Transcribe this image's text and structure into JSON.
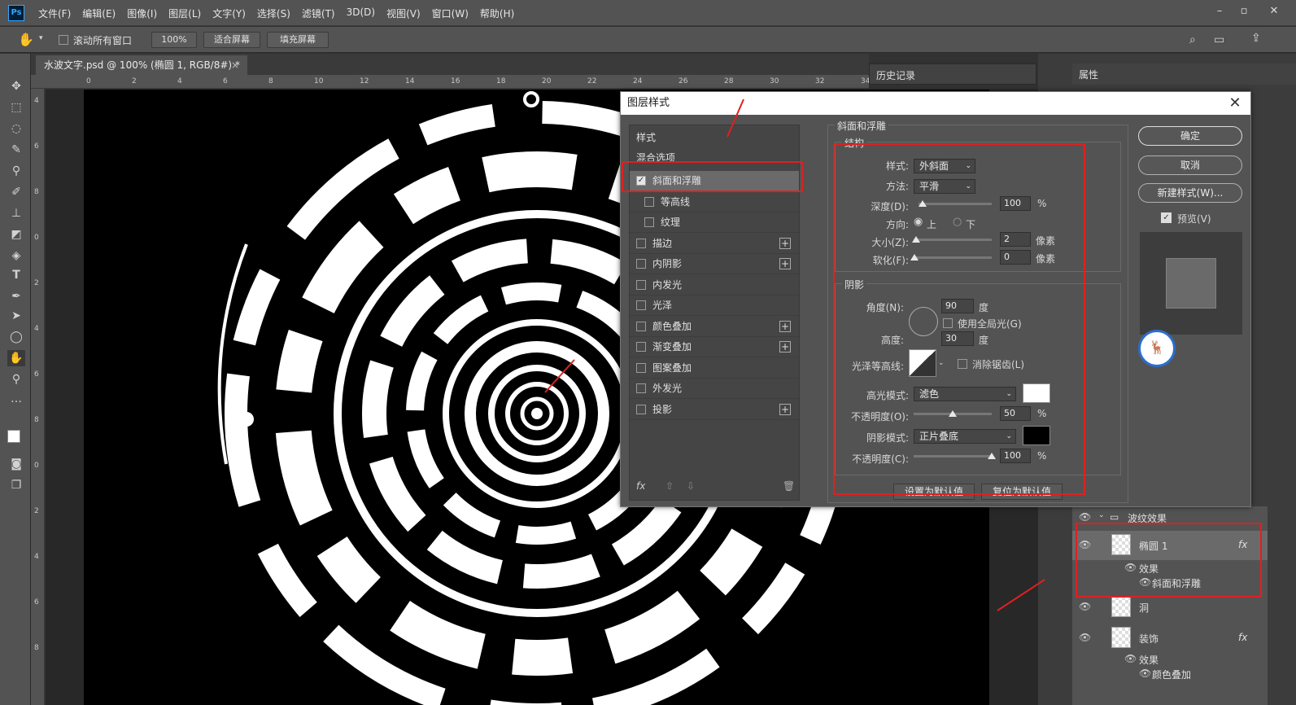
{
  "app": {
    "logo": "Ps"
  },
  "menu": [
    "文件(F)",
    "编辑(E)",
    "图像(I)",
    "图层(L)",
    "文字(Y)",
    "选择(S)",
    "滤镜(T)",
    "3D(D)",
    "视图(V)",
    "窗口(W)",
    "帮助(H)"
  ],
  "options": {
    "scroll_all": "滚动所有窗口",
    "zoom": "100%",
    "fit_screen": "适合屏幕",
    "fill_screen": "填充屏幕"
  },
  "document": {
    "tab_title": "水波文字.psd @ 100% (椭圆 1, RGB/8#) *"
  },
  "ruler_h": [
    "0",
    "2",
    "4",
    "6",
    "8",
    "10",
    "12",
    "14",
    "16",
    "18",
    "20",
    "22",
    "24",
    "26",
    "28",
    "30",
    "32",
    "34"
  ],
  "ruler_v": [
    "4",
    "6",
    "8",
    "0",
    "2",
    "4",
    "6",
    "8",
    "0",
    "2",
    "4",
    "6",
    "8"
  ],
  "panels": {
    "history": "历史记录",
    "properties": "属性"
  },
  "dialog": {
    "title": "图层样式",
    "list_header": "样式",
    "blend_options": "混合选项",
    "items": [
      {
        "label": "斜面和浮雕",
        "checked": true,
        "plus": false
      },
      {
        "label": "等高线",
        "checked": false,
        "plus": false
      },
      {
        "label": "纹理",
        "checked": false,
        "plus": false
      },
      {
        "label": "描边",
        "checked": false,
        "plus": true
      },
      {
        "label": "内阴影",
        "checked": false,
        "plus": true
      },
      {
        "label": "内发光",
        "checked": false,
        "plus": false
      },
      {
        "label": "光泽",
        "checked": false,
        "plus": false
      },
      {
        "label": "颜色叠加",
        "checked": false,
        "plus": true
      },
      {
        "label": "渐变叠加",
        "checked": false,
        "plus": true
      },
      {
        "label": "图案叠加",
        "checked": false,
        "plus": false
      },
      {
        "label": "外发光",
        "checked": false,
        "plus": false
      },
      {
        "label": "投影",
        "checked": false,
        "plus": true
      }
    ],
    "fx": "fx",
    "section_title": "斜面和浮雕",
    "structure": {
      "title": "结构",
      "style_label": "样式:",
      "style_value": "外斜面",
      "technique_label": "方法:",
      "technique_value": "平滑",
      "depth_label": "深度(D):",
      "depth_value": "100",
      "depth_unit": "%",
      "depth_level": 0.0,
      "direction_label": "方向:",
      "dir_up": "上",
      "dir_down": "下",
      "size_label": "大小(Z):",
      "size_value": "2",
      "size_unit": "像素",
      "soften_label": "软化(F):",
      "soften_value": "0",
      "soften_unit": "像素"
    },
    "shading": {
      "title": "阴影",
      "angle_label": "角度(N):",
      "angle_value": "90",
      "angle_unit": "度",
      "global_light": "使用全局光(G)",
      "altitude_label": "高度:",
      "altitude_value": "30",
      "altitude_unit": "度",
      "gloss_label": "光泽等高线:",
      "antialias": "消除锯齿(L)",
      "highlight_label": "高光模式:",
      "highlight_value": "滤色",
      "highlight_color": "#ffffff",
      "hl_opacity_label": "不透明度(O):",
      "hl_opacity_value": "50",
      "hl_opacity_unit": "%",
      "shadow_label": "阴影模式:",
      "shadow_value": "正片叠底",
      "shadow_color": "#000000",
      "sh_opacity_label": "不透明度(C):",
      "sh_opacity_value": "100",
      "sh_opacity_unit": "%"
    },
    "make_default": "设置为默认值",
    "reset_default": "复位为默认值",
    "ok": "确定",
    "cancel": "取消",
    "new_style": "新建样式(W)...",
    "preview": "预览(V)"
  },
  "layers": {
    "group": "波纹效果",
    "ellipse": "椭圆 1",
    "effects": "效果",
    "bevel": "斜面和浮雕",
    "hole": "洞",
    "deco": "装饰",
    "effects2": "效果",
    "color_overlay": "颜色叠加",
    "fx": "fx"
  }
}
